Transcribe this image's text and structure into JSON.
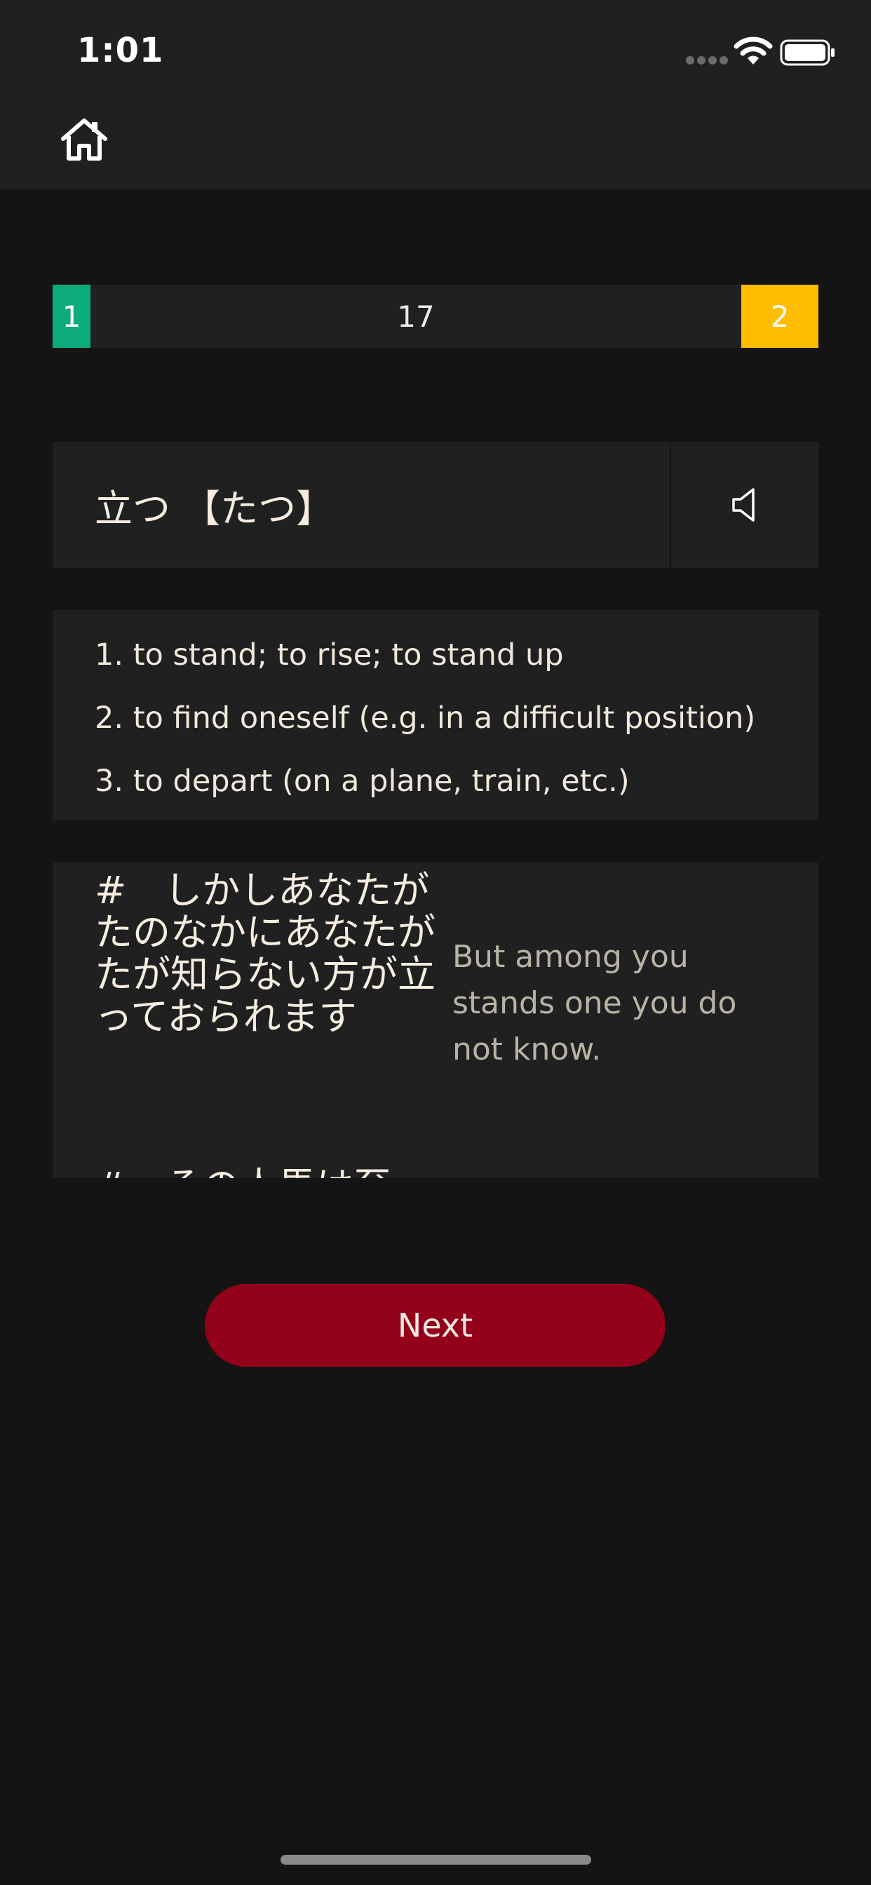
{
  "status_bar": {
    "time": "1:01",
    "icons": [
      "cellular-signal-icon",
      "wifi-icon",
      "battery-icon"
    ]
  },
  "nav": {
    "home_icon": "home-icon"
  },
  "progress": {
    "left_count": "1",
    "middle_count": "17",
    "right_count": "2",
    "colors": {
      "left": "#0BAB7B",
      "right": "#FCBD02"
    }
  },
  "word": {
    "text": "立つ 【たつ】",
    "audio_icon": "speaker-icon"
  },
  "definitions": [
    "1. to stand; to rise; to stand up",
    "2. to find oneself (e.g. in a difficult position)",
    "3. to depart (on a plane, train, etc.)"
  ],
  "examples": [
    {
      "japanese": "#　しかしあなたがたのなかにあなたがたが知らない方が立っておられます",
      "english": "But among you stands one you do not know."
    },
    {
      "japanese": "#　その人馬は至",
      "english": ""
    }
  ],
  "actions": {
    "next_label": "Next",
    "accent_color": "#92001A"
  }
}
